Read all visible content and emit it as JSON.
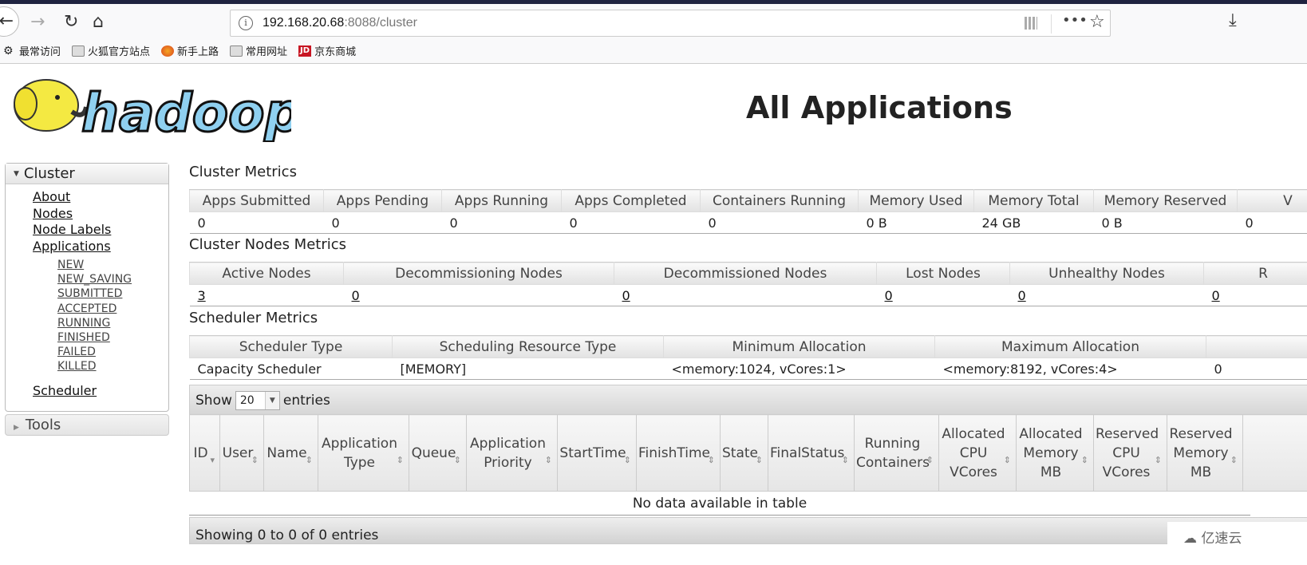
{
  "browser": {
    "url_host": "192.168.20.68",
    "url_rest": ":8088/cluster",
    "bookmarks": [
      {
        "label": "最常访问",
        "icon": "gear-icon"
      },
      {
        "label": "火狐官方站点",
        "icon": "folder-icon"
      },
      {
        "label": "新手上路",
        "icon": "firefox-icon"
      },
      {
        "label": "常用网址",
        "icon": "folder-icon"
      },
      {
        "label": "京东商城",
        "icon": "jd-icon",
        "badge": "JD"
      }
    ]
  },
  "logo_text": "hadoop",
  "page_title": "All Applications",
  "sidebar": {
    "cluster": "Cluster",
    "links": [
      "About",
      "Nodes",
      "Node Labels",
      "Applications"
    ],
    "states": [
      "NEW",
      "NEW_SAVING",
      "SUBMITTED",
      "ACCEPTED",
      "RUNNING",
      "FINISHED",
      "FAILED",
      "KILLED"
    ],
    "scheduler": "Scheduler",
    "tools": "Tools"
  },
  "cluster_metrics": {
    "title": "Cluster Metrics",
    "headers": [
      "Apps Submitted",
      "Apps Pending",
      "Apps Running",
      "Apps Completed",
      "Containers Running",
      "Memory Used",
      "Memory Total",
      "Memory Reserved",
      "V"
    ],
    "values": [
      "0",
      "0",
      "0",
      "0",
      "0",
      "0 B",
      "24 GB",
      "0 B",
      "0"
    ]
  },
  "node_metrics": {
    "title": "Cluster Nodes Metrics",
    "headers": [
      "Active Nodes",
      "Decommissioning Nodes",
      "Decommissioned Nodes",
      "Lost Nodes",
      "Unhealthy Nodes",
      "R"
    ],
    "values": [
      "3",
      "0",
      "0",
      "0",
      "0",
      "0"
    ]
  },
  "scheduler_metrics": {
    "title": "Scheduler Metrics",
    "headers": [
      "Scheduler Type",
      "Scheduling Resource Type",
      "Minimum Allocation",
      "Maximum Allocation",
      ""
    ],
    "values": [
      "Capacity Scheduler",
      "[MEMORY]",
      "<memory:1024, vCores:1>",
      "<memory:8192, vCores:4>",
      "0"
    ]
  },
  "apps_table": {
    "show": "Show",
    "page_size": "20",
    "entries": "entries",
    "headers": [
      "ID",
      "User",
      "Name",
      "Application Type",
      "Queue",
      "Application Priority",
      "StartTime",
      "FinishTime",
      "State",
      "FinalStatus",
      "Running Containers",
      "Allocated CPU VCores",
      "Allocated Memory MB",
      "Reserved CPU VCores",
      "Reserved Memory MB",
      ""
    ],
    "empty": "No data available in table",
    "info": "Showing 0 to 0 of 0 entries"
  },
  "watermark": "亿速云"
}
